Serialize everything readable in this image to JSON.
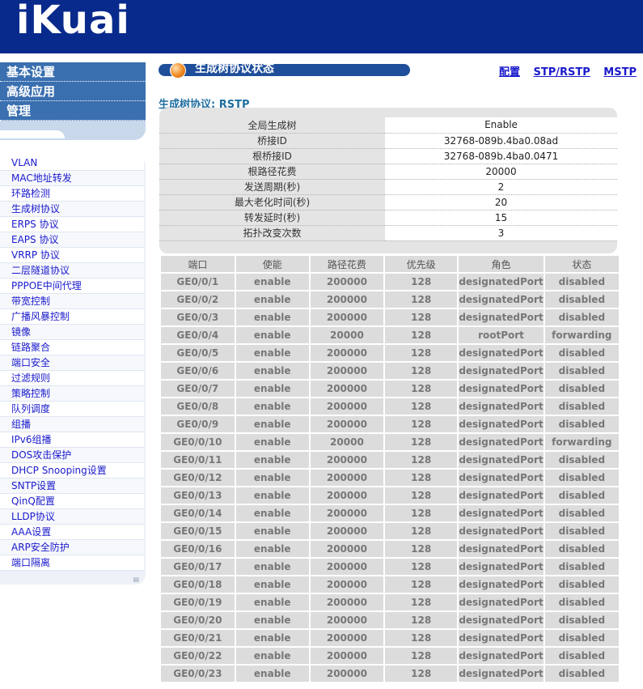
{
  "header": {
    "logo_text": "iKuai"
  },
  "topnav": [
    "基本设置",
    "高级应用",
    "管理"
  ],
  "subnav": [
    "VLAN",
    "MAC地址转发",
    "环路检测",
    "生成树协议",
    "ERPS 协议",
    "EAPS 协议",
    "VRRP 协议",
    "二层隧道协议",
    "PPPOE中间代理",
    "带宽控制",
    "广播风暴控制",
    "镜像",
    "链路聚合",
    "端口安全",
    "过滤规则",
    "策略控制",
    "队列调度",
    "组播",
    "IPv6组播",
    "DOS攻击保护",
    "DHCP Snooping设置",
    "SNTP设置",
    "QinQ配置",
    "LLDP协议",
    "AAA设置",
    "ARP安全防护",
    "端口隔离"
  ],
  "title": "生成树协议状态",
  "links": [
    "配置",
    "STP/RSTP",
    "MSTP"
  ],
  "protocol_label": "生成树协议: RSTP",
  "info": [
    {
      "k": "全局生成树",
      "v": "Enable"
    },
    {
      "k": "桥接ID",
      "v": "32768-089b.4ba0.08ad"
    },
    {
      "k": "根桥接ID",
      "v": "32768-089b.4ba0.0471"
    },
    {
      "k": "根路径花费",
      "v": "20000"
    },
    {
      "k": "发送周期(秒)",
      "v": "2"
    },
    {
      "k": "最大老化时间(秒)",
      "v": "20"
    },
    {
      "k": "转发延时(秒)",
      "v": "15"
    },
    {
      "k": "拓扑改变次数",
      "v": "3"
    }
  ],
  "port_headers": [
    "端口",
    "使能",
    "路径花费",
    "优先级",
    "角色",
    "状态"
  ],
  "ports": [
    [
      "GE0/0/1",
      "enable",
      "200000",
      "128",
      "designatedPort",
      "disabled"
    ],
    [
      "GE0/0/2",
      "enable",
      "200000",
      "128",
      "designatedPort",
      "disabled"
    ],
    [
      "GE0/0/3",
      "enable",
      "200000",
      "128",
      "designatedPort",
      "disabled"
    ],
    [
      "GE0/0/4",
      "enable",
      "20000",
      "128",
      "rootPort",
      "forwarding"
    ],
    [
      "GE0/0/5",
      "enable",
      "200000",
      "128",
      "designatedPort",
      "disabled"
    ],
    [
      "GE0/0/6",
      "enable",
      "200000",
      "128",
      "designatedPort",
      "disabled"
    ],
    [
      "GE0/0/7",
      "enable",
      "200000",
      "128",
      "designatedPort",
      "disabled"
    ],
    [
      "GE0/0/8",
      "enable",
      "200000",
      "128",
      "designatedPort",
      "disabled"
    ],
    [
      "GE0/0/9",
      "enable",
      "200000",
      "128",
      "designatedPort",
      "disabled"
    ],
    [
      "GE0/0/10",
      "enable",
      "20000",
      "128",
      "designatedPort",
      "forwarding"
    ],
    [
      "GE0/0/11",
      "enable",
      "200000",
      "128",
      "designatedPort",
      "disabled"
    ],
    [
      "GE0/0/12",
      "enable",
      "200000",
      "128",
      "designatedPort",
      "disabled"
    ],
    [
      "GE0/0/13",
      "enable",
      "200000",
      "128",
      "designatedPort",
      "disabled"
    ],
    [
      "GE0/0/14",
      "enable",
      "200000",
      "128",
      "designatedPort",
      "disabled"
    ],
    [
      "GE0/0/15",
      "enable",
      "200000",
      "128",
      "designatedPort",
      "disabled"
    ],
    [
      "GE0/0/16",
      "enable",
      "200000",
      "128",
      "designatedPort",
      "disabled"
    ],
    [
      "GE0/0/17",
      "enable",
      "200000",
      "128",
      "designatedPort",
      "disabled"
    ],
    [
      "GE0/0/18",
      "enable",
      "200000",
      "128",
      "designatedPort",
      "disabled"
    ],
    [
      "GE0/0/19",
      "enable",
      "200000",
      "128",
      "designatedPort",
      "disabled"
    ],
    [
      "GE0/0/20",
      "enable",
      "200000",
      "128",
      "designatedPort",
      "disabled"
    ],
    [
      "GE0/0/21",
      "enable",
      "200000",
      "128",
      "designatedPort",
      "disabled"
    ],
    [
      "GE0/0/22",
      "enable",
      "200000",
      "128",
      "designatedPort",
      "disabled"
    ],
    [
      "GE0/0/23",
      "enable",
      "200000",
      "128",
      "designatedPort",
      "disabled"
    ]
  ],
  "colors": {
    "header_bg": "#082a8c",
    "nav_blue": "#3a6fb0",
    "link": "#1a1acc",
    "title_bar": "#1f4f9a"
  }
}
